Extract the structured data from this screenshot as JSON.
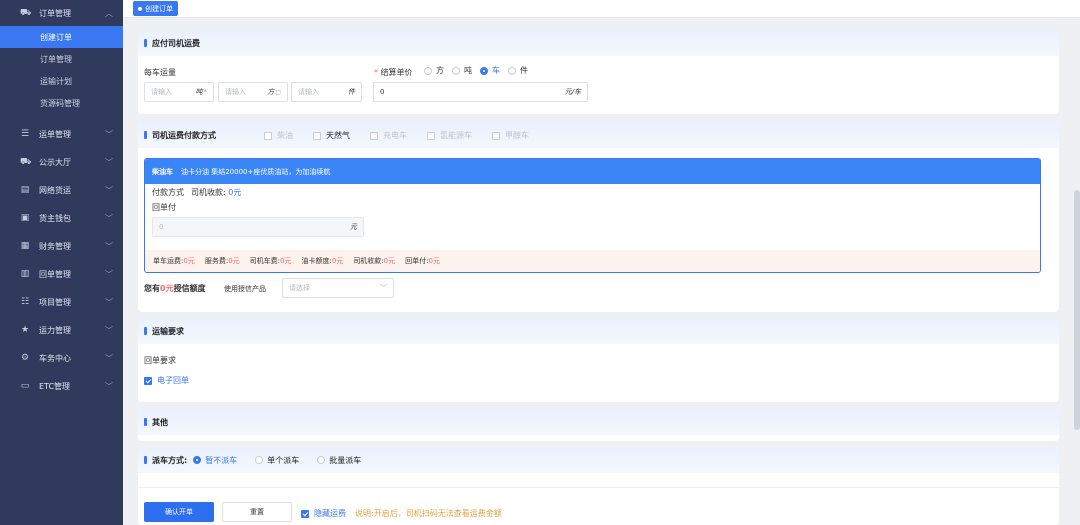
{
  "sidebar": {
    "groups": [
      {
        "label": "订单管理",
        "icon": "truck-icon",
        "expanded": true
      },
      {
        "label": "运单管理",
        "icon": "list-icon"
      },
      {
        "label": "公示大厅",
        "icon": "truck-icon"
      },
      {
        "label": "网络货运",
        "icon": "document-icon"
      },
      {
        "label": "货主钱包",
        "icon": "wallet-icon"
      },
      {
        "label": "财务管理",
        "icon": "finance-icon"
      },
      {
        "label": "回单管理",
        "icon": "receipt-icon"
      },
      {
        "label": "项目管理",
        "icon": "project-icon"
      },
      {
        "label": "运力管理",
        "icon": "star-icon"
      },
      {
        "label": "车务中心",
        "icon": "gear-icon"
      },
      {
        "label": "ETC管理",
        "icon": "etc-icon"
      }
    ],
    "sub_items": [
      "创建订单",
      "订单管理",
      "运输计划",
      "货源码管理"
    ],
    "active_sub": "创建订单"
  },
  "tabbar": {
    "active_tab": "创建订单"
  },
  "freight": {
    "title": "应付司机运费",
    "per_car_label": "每车运量",
    "inputs": [
      {
        "placeholder": "请输入",
        "unit": "吨"
      },
      {
        "placeholder": "请输入",
        "unit": "方"
      },
      {
        "placeholder": "请输入",
        "unit": "件"
      }
    ],
    "unit_price_label": "结算单价",
    "unit_price_options": [
      "方",
      "吨",
      "车",
      "件"
    ],
    "unit_price_selected": "车",
    "unit_price_value": "0",
    "unit_price_unit": "元/车"
  },
  "payment": {
    "title": "司机运费付款方式",
    "options": [
      "柴油",
      "天然气",
      "充电车",
      "氢能源车",
      "甲醇车"
    ],
    "fuel_card": {
      "name": "柴油车",
      "desc": "油卡分油 集结20000+座优质油站，为加油续航",
      "pay_method_label": "付款方式",
      "driver_receive_label": "司机收款:",
      "driver_receive_value": "0元",
      "receipt_label": "回单付",
      "receipt_value": "0",
      "receipt_unit": "元"
    },
    "summary": [
      {
        "label": "单车运费:",
        "value": "0元"
      },
      {
        "label": "服务费:",
        "value": "0元"
      },
      {
        "label": "司机车费:",
        "value": "0元"
      },
      {
        "label": "油卡额度:",
        "value": "0元"
      },
      {
        "label": "司机收款:",
        "value": "0元"
      },
      {
        "label": "回单付:",
        "value": "0元"
      }
    ],
    "credit_prefix": "您有",
    "credit_value": "0元",
    "credit_suffix": "授信额度",
    "credit_product_label": "使用授信产品",
    "credit_product_placeholder": "请选择"
  },
  "transport": {
    "title": "运输要求",
    "receipt_req_label": "回单要求",
    "e_receipt_label": "电子回单"
  },
  "other": {
    "title": "其他"
  },
  "dispatch": {
    "title": "派车方式:",
    "options": [
      "暂不派车",
      "单个派车",
      "批量派车"
    ],
    "selected": "暂不派车"
  },
  "footer": {
    "confirm_label": "确认开单",
    "reset_label": "重置",
    "hide_fee_label": "隐藏运费",
    "note": "说明:开启后，司机扫码无法查看运费金额"
  },
  "colors": {
    "primary": "#3a78f2",
    "sidebar_bg": "#2f3a5c",
    "danger": "#f56c6c",
    "warning": "#e6a23c"
  }
}
